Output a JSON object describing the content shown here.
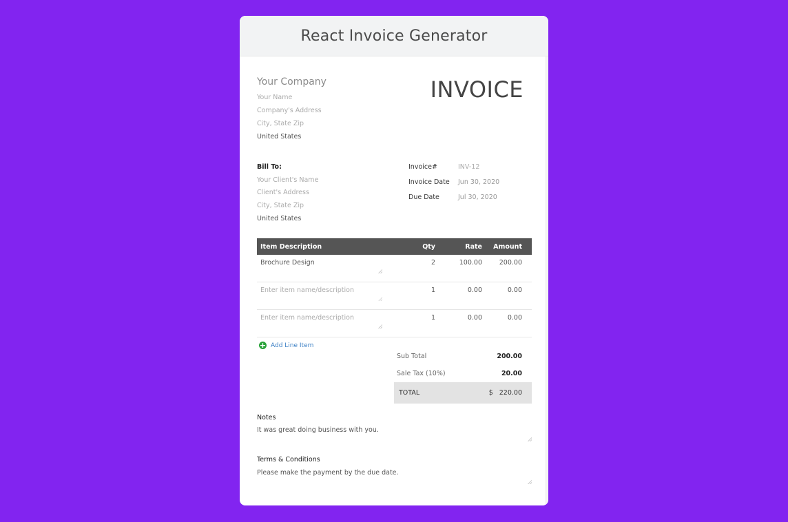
{
  "app": {
    "title": "React Invoice Generator"
  },
  "colors": {
    "background": "#8224f0",
    "header_bg": "#f2f3f4",
    "table_header_bg": "#555555",
    "add_icon": "#2aa23a",
    "link": "#3b7fc4",
    "total_bg": "#e3e3e3"
  },
  "sender": {
    "company_placeholder": "Your Company",
    "name_placeholder": "Your Name",
    "address_placeholder": "Company's Address",
    "city_placeholder": "City, State Zip",
    "country": "United States"
  },
  "invoice_title": "INVOICE",
  "bill_to": {
    "label": "Bill To:",
    "name_placeholder": "Your Client's Name",
    "address_placeholder": "Client's Address",
    "city_placeholder": "City, State Zip",
    "country": "United States"
  },
  "meta": {
    "invoice_no_label": "Invoice#",
    "invoice_no_placeholder": "INV-12",
    "invoice_date_label": "Invoice Date",
    "invoice_date_value": "Jun 30, 2020",
    "due_date_label": "Due Date",
    "due_date_value": "Jul 30, 2020"
  },
  "table": {
    "headers": {
      "description": "Item Description",
      "qty": "Qty",
      "rate": "Rate",
      "amount": "Amount"
    },
    "rows": [
      {
        "description": "Brochure Design",
        "placeholder": "Enter item name/description",
        "qty": "2",
        "rate": "100.00",
        "amount": "200.00"
      },
      {
        "description": "",
        "placeholder": "Enter item name/description",
        "qty": "1",
        "rate": "0.00",
        "amount": "0.00"
      },
      {
        "description": "",
        "placeholder": "Enter item name/description",
        "qty": "1",
        "rate": "0.00",
        "amount": "0.00"
      }
    ]
  },
  "add_line_label": "Add Line Item",
  "add_icon": "plus-circle-icon",
  "totals": {
    "subtotal_label": "Sub Total",
    "subtotal_value": "200.00",
    "tax_label": "Sale Tax (10%)",
    "tax_value": "20.00",
    "total_label": "TOTAL",
    "currency": "$",
    "total_value": "220.00"
  },
  "notes": {
    "label": "Notes",
    "value": "It was great doing business with you."
  },
  "terms": {
    "label": "Terms & Conditions",
    "value": "Please make the payment by the due date."
  }
}
